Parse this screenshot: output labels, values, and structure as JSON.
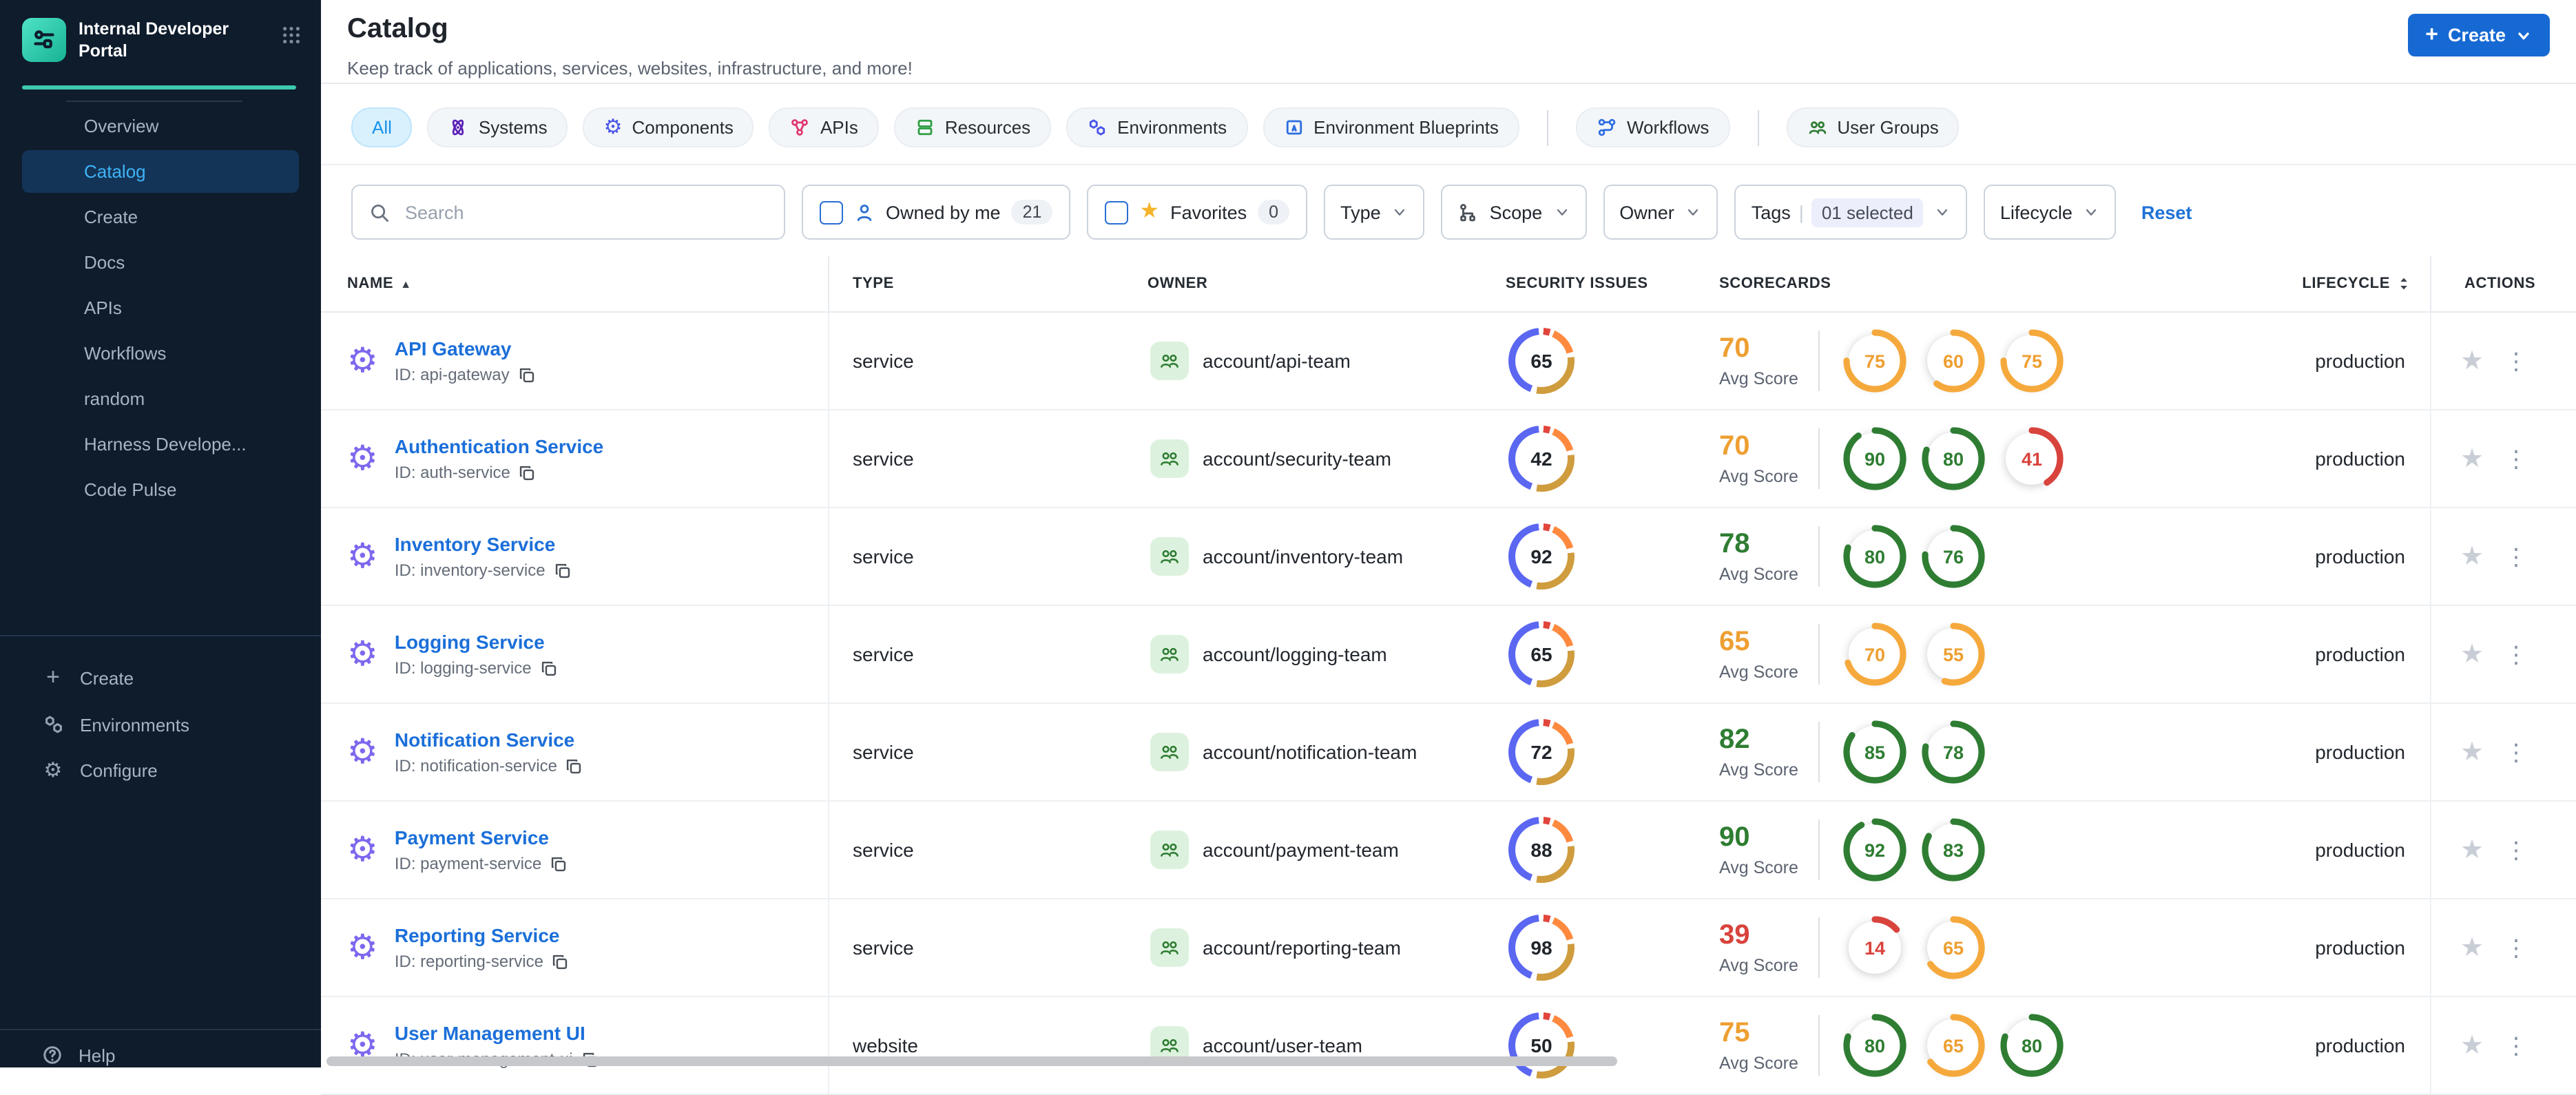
{
  "brand": {
    "title": "Internal Developer Portal"
  },
  "sidebar": {
    "items": [
      {
        "label": "Overview",
        "active": false
      },
      {
        "label": "Catalog",
        "active": true
      },
      {
        "label": "Create",
        "active": false
      },
      {
        "label": "Docs",
        "active": false
      },
      {
        "label": "APIs",
        "active": false
      },
      {
        "label": "Workflows",
        "active": false
      },
      {
        "label": "random",
        "active": false
      },
      {
        "label": "Harness Develope...",
        "active": false
      },
      {
        "label": "Code Pulse",
        "active": false
      }
    ],
    "bottom_items": [
      {
        "label": "Create",
        "icon": "plus-icon"
      },
      {
        "label": "Environments",
        "icon": "hexagons-icon"
      },
      {
        "label": "Configure",
        "icon": "gear-icon"
      }
    ],
    "footer_items": [
      {
        "label": "Help",
        "icon": "help-icon"
      }
    ]
  },
  "header": {
    "title": "Catalog",
    "subtitle": "Keep track of applications, services, websites, infrastructure, and more!",
    "create_label": "Create"
  },
  "tabs": [
    {
      "label": "All",
      "active": true
    },
    {
      "label": "Systems",
      "icon": "systems-icon",
      "icon_color": "#5b21b6"
    },
    {
      "label": "Components",
      "icon": "components-gear-icon",
      "icon_color": "#4955e8"
    },
    {
      "label": "APIs",
      "icon": "api-icon",
      "icon_color": "#e0366f"
    },
    {
      "label": "Resources",
      "icon": "resources-icon",
      "icon_color": "#2f9e44"
    },
    {
      "label": "Environments",
      "icon": "hexagons-icon",
      "icon_color": "#4955e8"
    },
    {
      "label": "Environment Blueprints",
      "icon": "blueprint-icon",
      "icon_color": "#2d6ee0"
    },
    {
      "label": "Workflows",
      "icon": "workflow-icon",
      "icon_color": "#2d6ee0",
      "group_start": true
    },
    {
      "label": "User Groups",
      "icon": "user-groups-icon",
      "icon_color": "#2f7d33",
      "group_start": true
    }
  ],
  "filters": {
    "search_placeholder": "Search",
    "owned_by_me": {
      "label": "Owned by me",
      "count": "21"
    },
    "favorites": {
      "label": "Favorites",
      "count": "0"
    },
    "dropdowns": [
      {
        "label": "Type"
      },
      {
        "label": "Scope",
        "icon": "scope-icon"
      },
      {
        "label": "Owner"
      },
      {
        "label": "Tags",
        "chip": "01 selected"
      },
      {
        "label": "Lifecycle"
      }
    ],
    "reset_label": "Reset"
  },
  "table": {
    "columns": [
      "NAME",
      "TYPE",
      "OWNER",
      "SECURITY ISSUES",
      "SCORECARDS",
      "LIFECYCLE",
      "ACTIONS"
    ],
    "avg_score_label": "Avg Score",
    "id_prefix": "ID: ",
    "rows": [
      {
        "name": "API Gateway",
        "id": "api-gateway",
        "type": "service",
        "owner": "account/api-team",
        "security_issues": 65,
        "avg_score": 70,
        "scores": [
          75,
          60,
          75
        ],
        "lifecycle": "production"
      },
      {
        "name": "Authentication Service",
        "id": "auth-service",
        "type": "service",
        "owner": "account/security-team",
        "security_issues": 42,
        "avg_score": 70,
        "scores": [
          90,
          80,
          41
        ],
        "lifecycle": "production"
      },
      {
        "name": "Inventory Service",
        "id": "inventory-service",
        "type": "service",
        "owner": "account/inventory-team",
        "security_issues": 92,
        "avg_score": 78,
        "scores": [
          80,
          76
        ],
        "lifecycle": "production"
      },
      {
        "name": "Logging Service",
        "id": "logging-service",
        "type": "service",
        "owner": "account/logging-team",
        "security_issues": 65,
        "avg_score": 65,
        "scores": [
          70,
          55
        ],
        "lifecycle": "production"
      },
      {
        "name": "Notification Service",
        "id": "notification-service",
        "type": "service",
        "owner": "account/notification-team",
        "security_issues": 72,
        "avg_score": 82,
        "scores": [
          85,
          78
        ],
        "lifecycle": "production"
      },
      {
        "name": "Payment Service",
        "id": "payment-service",
        "type": "service",
        "owner": "account/payment-team",
        "security_issues": 88,
        "avg_score": 90,
        "scores": [
          92,
          83
        ],
        "lifecycle": "production"
      },
      {
        "name": "Reporting Service",
        "id": "reporting-service",
        "type": "service",
        "owner": "account/reporting-team",
        "security_issues": 98,
        "avg_score": 39,
        "scores": [
          14,
          65
        ],
        "lifecycle": "production"
      },
      {
        "name": "User Management UI",
        "id": "user-management-ui",
        "type": "website",
        "owner": "account/user-team",
        "security_issues": 50,
        "avg_score": 75,
        "scores": [
          80,
          65,
          80
        ],
        "lifecycle": "production"
      }
    ]
  },
  "theme": {
    "sidebar_bg": "#0e1c2c",
    "sidebar_accent": "#3ec9ae",
    "active_nav_bg": "#133457",
    "active_nav_text": "#3fb3f6",
    "link_blue": "#1b6fd9",
    "button_blue": "#1669d2",
    "score_green": "#2e7d32",
    "score_orange": "#ee9f32",
    "score_red": "#d8433c",
    "donut_blue": "#5b67f1",
    "donut_red": "#e2453c",
    "donut_orange": "#ff8a3f",
    "donut_gold": "#cf9c3e"
  }
}
